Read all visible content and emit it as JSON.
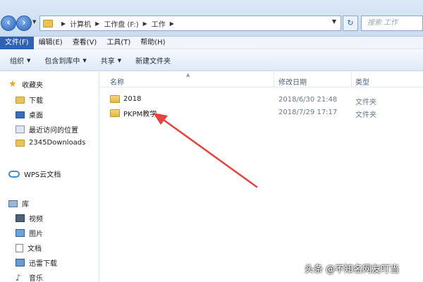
{
  "address_bar": {
    "breadcrumbs": [
      "计算机",
      "工作盘 (F:)",
      "工作"
    ],
    "search_placeholder": "搜索 工作"
  },
  "menu": {
    "items": [
      "文件(F)",
      "编辑(E)",
      "查看(V)",
      "工具(T)",
      "帮助(H)"
    ]
  },
  "toolbar": {
    "organize": "组织",
    "include_library": "包含到库中",
    "share": "共享",
    "new_folder": "新建文件夹"
  },
  "sidebar": {
    "favorites": "收藏夹",
    "favorites_items": [
      "下载",
      "桌面",
      "最近访问的位置",
      "2345Downloads"
    ],
    "wps_cloud": "WPS云文档",
    "library": "库",
    "library_items": [
      "视频",
      "图片",
      "文档",
      "迅雷下载",
      "音乐"
    ]
  },
  "columns": {
    "name": "名称",
    "date": "修改日期",
    "type": "类型"
  },
  "files": [
    {
      "name": "2018",
      "date": "2018/6/30 21:48",
      "type": "文件夹"
    },
    {
      "name": "PKPM教学",
      "date": "2018/7/29 17:17",
      "type": "文件夹"
    }
  ],
  "annotation": {
    "color": "#e8423f"
  },
  "watermark": "头条 @不知名网友叮当"
}
